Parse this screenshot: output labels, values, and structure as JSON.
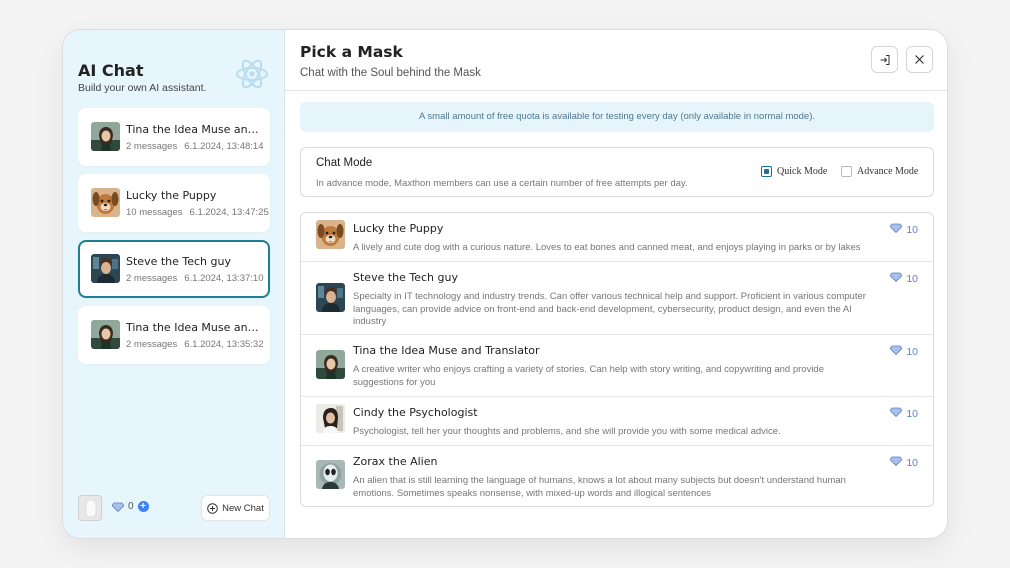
{
  "sidebar": {
    "title": "AI Chat",
    "subtitle": "Build your own AI assistant.",
    "chats": [
      {
        "title": "Tina the Idea Muse and Translator",
        "count": "2 messages",
        "time": "6.1.2024, 13:48:14",
        "avatar": "tina",
        "active": false
      },
      {
        "title": "Lucky the Puppy",
        "count": "10 messages",
        "time": "6.1.2024, 13:47:25",
        "avatar": "puppy",
        "active": false
      },
      {
        "title": "Steve the Tech guy",
        "count": "2 messages",
        "time": "6.1.2024, 13:37:10",
        "avatar": "steve",
        "active": true
      },
      {
        "title": "Tina the Idea Muse and Translator",
        "count": "2 messages",
        "time": "6.1.2024, 13:35:32",
        "avatar": "tina",
        "active": false
      }
    ],
    "quota": "0",
    "new_chat_label": "New Chat"
  },
  "header": {
    "title": "Pick a Mask",
    "subtitle": "Chat with the Soul behind the Mask"
  },
  "notice": "A small amount of free quota is available for testing every day (only available in normal mode).",
  "chat_mode": {
    "title": "Chat Mode",
    "description": "In advance mode, Maxthon members can use a certain number of free attempts per day.",
    "options": [
      {
        "label": "Quick Mode",
        "checked": true
      },
      {
        "label": "Advance Mode",
        "checked": false
      }
    ]
  },
  "masks": [
    {
      "name": "Lucky the Puppy",
      "description": "A lively and cute dog with a curious nature. Loves to eat bones and canned meat, and enjoys playing in parks or by lakes",
      "cost": "10",
      "avatar": "puppy"
    },
    {
      "name": "Steve the Tech guy",
      "description": "Specialty in IT technology and industry trends. Can offer various technical help and support. Proficient in various computer languages, can provide advice on front-end and back-end development, cybersecurity, product design, and even the AI industry",
      "cost": "10",
      "avatar": "steve"
    },
    {
      "name": "Tina the Idea Muse and Translator",
      "description": "A creative writer who enjoys crafting a variety of stories. Can help with story writing, and copywriting and provide suggestions for you",
      "cost": "10",
      "avatar": "tina"
    },
    {
      "name": "Cindy the Psychologist",
      "description": "Psychologist, tell her your thoughts and problems, and she will provide you with some medical advice.",
      "cost": "10",
      "avatar": "cindy"
    },
    {
      "name": "Zorax the Alien",
      "description": "An alien that is still learning the language of humans, knows a lot about many subjects but doesn't understand human emotions. Sometimes speaks nonsense, with mixed-up words and illogical sentences",
      "cost": "10",
      "avatar": "alien"
    }
  ],
  "colors": {
    "accent": "#1d8090",
    "sidebar_bg": "#e7f5fc",
    "notice_bg": "#e6f4fb",
    "diamond": "#5b82c9"
  }
}
